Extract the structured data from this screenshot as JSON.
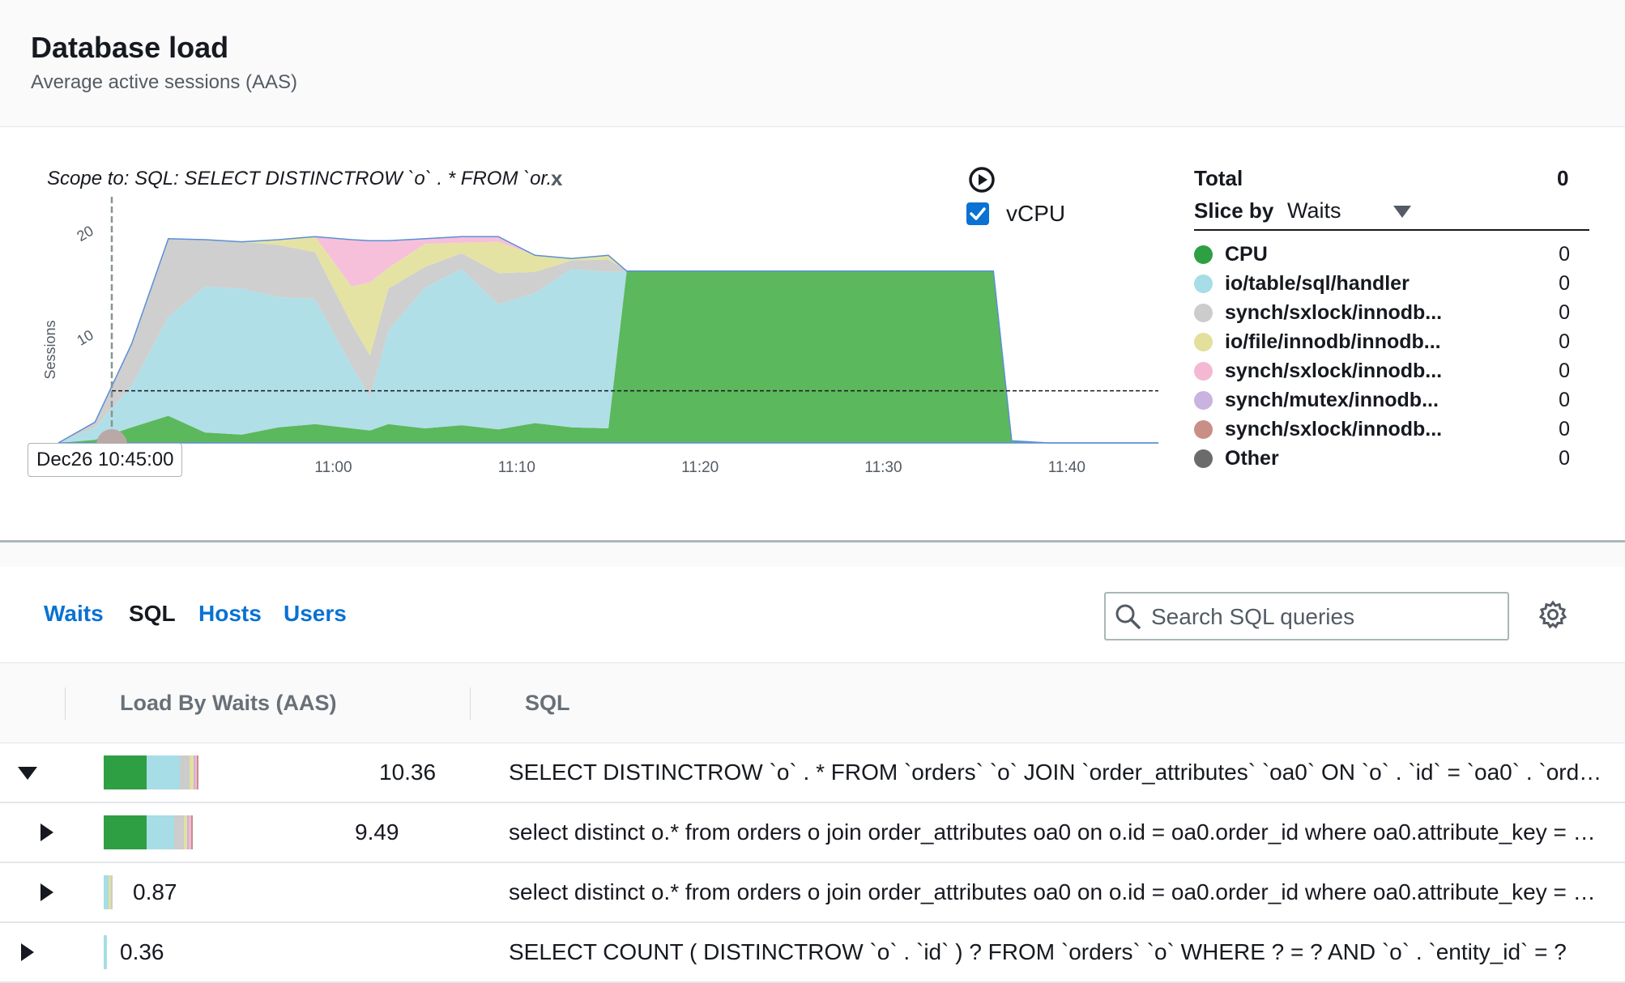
{
  "header": {
    "title": "Database load",
    "subtitle": "Average active sessions (AAS)"
  },
  "chart_panel": {
    "scope_text": "Scope to: SQL: SELECT DISTINCTROW `o` . * FROM `or...",
    "scope_clear_label": "x",
    "vcpu_label": "vCPU",
    "vcpu_checked": true,
    "tooltip": "Dec26 10:45:00",
    "ylabel": "Sessions"
  },
  "legend": {
    "total_label": "Total",
    "total_value": "0",
    "slice_label": "Slice by",
    "slice_value": "Waits",
    "items": [
      {
        "name": "CPU",
        "value": "0",
        "color": "#2ea043"
      },
      {
        "name": "io/table/sql/handler",
        "value": "0",
        "color": "#a6dde6"
      },
      {
        "name": "synch/sxlock/innodb...",
        "value": "0",
        "color": "#cccccc"
      },
      {
        "name": "io/file/innodb/innodb...",
        "value": "0",
        "color": "#e2e09c"
      },
      {
        "name": "synch/sxlock/innodb...",
        "value": "0",
        "color": "#f5b8d4"
      },
      {
        "name": "synch/mutex/innodb...",
        "value": "0",
        "color": "#c9b3e0"
      },
      {
        "name": "synch/sxlock/innodb...",
        "value": "0",
        "color": "#c98f86"
      },
      {
        "name": "Other",
        "value": "0",
        "color": "#6b6b6b"
      }
    ]
  },
  "chart_data": {
    "type": "area",
    "ylabel": "Sessions",
    "x_ticks": [
      "50",
      "11:00",
      "11:10",
      "11:20",
      "11:30",
      "11:40"
    ],
    "y_ticks": [
      10,
      20
    ],
    "ylim": [
      0,
      23
    ],
    "vcpu_line": 5,
    "x": [
      "10:45",
      "10:47",
      "10:49",
      "10:51",
      "10:53",
      "10:55",
      "10:57",
      "10:59",
      "11:01",
      "11:02",
      "11:03",
      "11:05",
      "11:07",
      "11:09",
      "11:11",
      "11:13",
      "11:15",
      "11:16",
      "11:17",
      "11:19",
      "11:21",
      "11:23",
      "11:25",
      "11:27",
      "11:29",
      "11:31",
      "11:33",
      "11:35",
      "11:36",
      "11:37",
      "11:39",
      "11:41",
      "11:43",
      "11:45"
    ],
    "series": [
      {
        "name": "CPU",
        "color": "#5cb85c",
        "values": [
          0,
          0.3,
          1.5,
          2.6,
          1.0,
          0.8,
          1.5,
          1.8,
          1.4,
          1.2,
          1.8,
          1.4,
          1.7,
          1.3,
          1.9,
          1.5,
          1.4,
          16.5,
          16.5,
          16.5,
          16.5,
          16.5,
          16.5,
          16.5,
          16.5,
          16.5,
          16.5,
          16.5,
          16.5,
          0.2,
          0,
          0,
          0,
          0
        ]
      },
      {
        "name": "io/table/sql/handler",
        "color": "#b0dfe7",
        "values": [
          0,
          1.2,
          4.0,
          9.5,
          14.0,
          14.0,
          12.5,
          12.0,
          6.0,
          3.2,
          9.0,
          13.5,
          15.0,
          12.0,
          12.5,
          15.2,
          15.0,
          0,
          0,
          0,
          0,
          0,
          0,
          0,
          0,
          0,
          0,
          0,
          0,
          0,
          0,
          0,
          0,
          0
        ]
      },
      {
        "name": "synch/sxlock/innodb...",
        "color": "#cfcfcf",
        "values": [
          0,
          0.5,
          4.0,
          7.5,
          4.5,
          4.5,
          5.0,
          4.5,
          4.0,
          4.0,
          4.0,
          2.0,
          1.5,
          3.0,
          2.0,
          0.8,
          1.2,
          0,
          0,
          0,
          0,
          0,
          0,
          0,
          0,
          0,
          0,
          0,
          0,
          0,
          0,
          0,
          0,
          0
        ]
      },
      {
        "name": "io/file/innodb/innodb...",
        "color": "#e5e3a3",
        "values": [
          0,
          0,
          0,
          0,
          0,
          0,
          0.5,
          1.5,
          3.6,
          7.0,
          2.0,
          2.2,
          1.0,
          3.0,
          1.6,
          0.2,
          0.4,
          0,
          0,
          0,
          0,
          0,
          0,
          0,
          0,
          0,
          0,
          0,
          0,
          0,
          0,
          0,
          0,
          0
        ]
      },
      {
        "name": "synch/sxlock/innodb...",
        "color": "#f6c0da",
        "values": [
          0,
          0,
          0,
          0,
          0,
          0,
          0,
          0,
          4.5,
          4.0,
          2.6,
          0.5,
          0.6,
          0.5,
          0,
          0,
          0,
          0,
          0,
          0,
          0,
          0,
          0,
          0,
          0,
          0,
          0,
          0,
          0,
          0,
          0,
          0,
          0,
          0
        ]
      }
    ]
  },
  "tabs": [
    "Waits",
    "SQL",
    "Hosts",
    "Users"
  ],
  "active_tab": "SQL",
  "search": {
    "placeholder": "Search SQL queries",
    "value": ""
  },
  "table": {
    "columns": [
      "Load By Waits (AAS)",
      "SQL"
    ],
    "rows": [
      {
        "load": "10.36",
        "expanded": true,
        "sql": "SELECT DISTINCTROW `o` . * FROM `orders` `o` JOIN `order_attributes` `oa0` ON `o` . `id` = `oa0` . `order_id` WHERE ...",
        "breakdown": [
          {
            "color": "#2ea043",
            "value": 4.6
          },
          {
            "color": "#a6dde6",
            "value": 3.6
          },
          {
            "color": "#cccccc",
            "value": 1.0
          },
          {
            "color": "#e2e09c",
            "value": 0.45
          },
          {
            "color": "#c9b3e0",
            "value": 0.15
          },
          {
            "color": "#f5b8d4",
            "value": 0.2
          },
          {
            "color": "#c98f86",
            "value": 0.05
          }
        ]
      },
      {
        "load": "9.49",
        "expanded": false,
        "sql": "select distinct o.* from orders o join order_attributes oa0 on o.id = oa0.order_id where oa0.attribute_key = ? and ...",
        "breakdown": [
          {
            "color": "#2ea043",
            "value": 4.6
          },
          {
            "color": "#a6dde6",
            "value": 3.0
          },
          {
            "color": "#cccccc",
            "value": 1.0
          },
          {
            "color": "#e2e09c",
            "value": 0.4
          },
          {
            "color": "#c9b3e0",
            "value": 0.14
          },
          {
            "color": "#f5b8d4",
            "value": 0.18
          },
          {
            "color": "#c98f86",
            "value": 0.04
          }
        ]
      },
      {
        "load": "0.87",
        "expanded": false,
        "sql": "select distinct o.* from orders o join order_attributes oa0 on o.id = oa0.order_id where oa0.attribute_key = ? and ...",
        "breakdown": [
          {
            "color": "#a6dde6",
            "value": 0.55
          },
          {
            "color": "#e2e09c",
            "value": 0.24
          },
          {
            "color": "#cccccc",
            "value": 0.08
          }
        ]
      },
      {
        "load": "0.36",
        "expanded": false,
        "sql": "SELECT COUNT ( DISTINCTROW `o` . `id` ) ? FROM `orders` `o` WHERE ? = ? AND `o` . `entity_id` = ?",
        "breakdown": [
          {
            "color": "#a6dde6",
            "value": 0.36
          }
        ]
      }
    ]
  }
}
